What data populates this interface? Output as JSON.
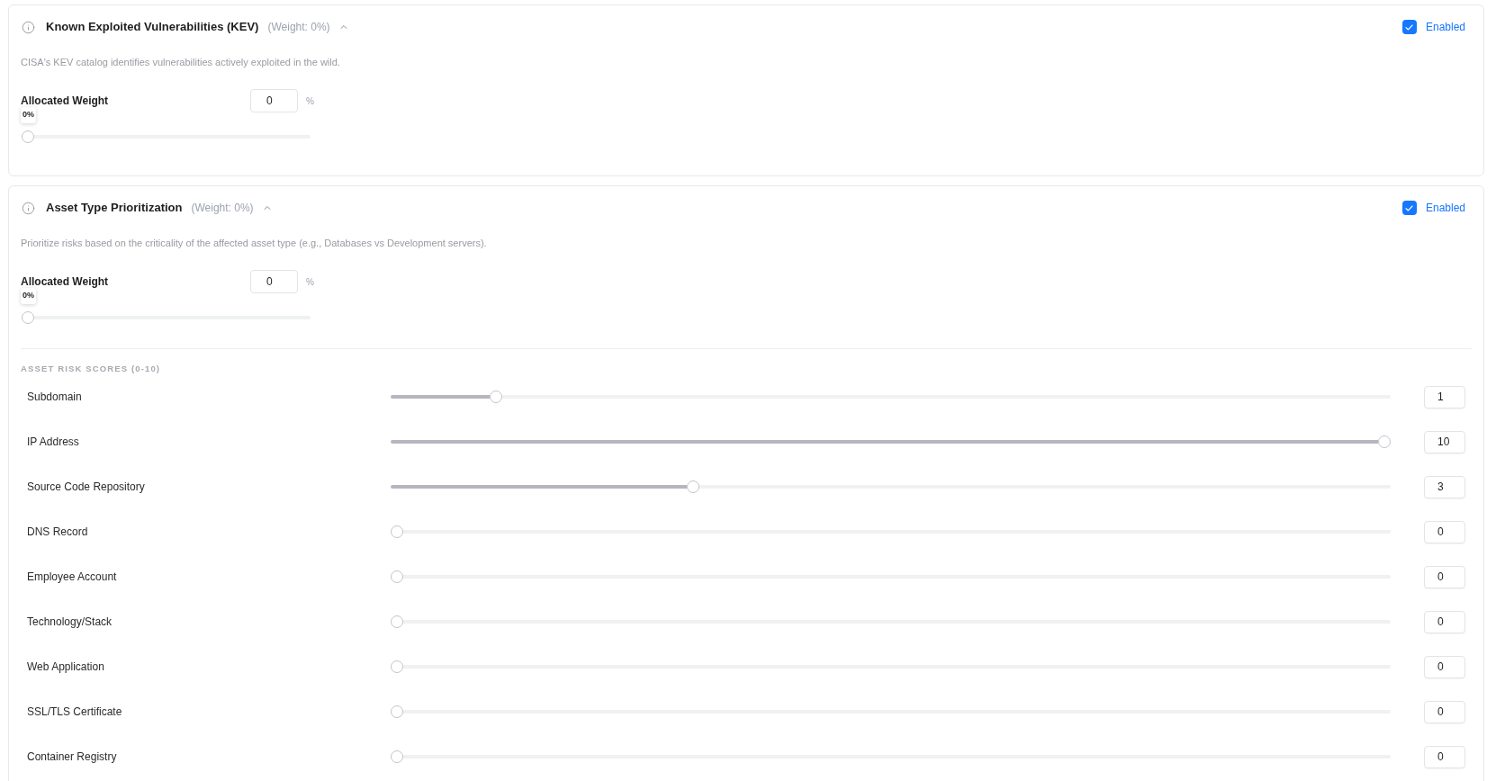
{
  "sections": [
    {
      "title": "Known Exploited Vulnerabilities (KEV)",
      "weight_label": "(Weight: 0%)",
      "expanded": true,
      "enabled": {
        "label": "Enabled",
        "checked": true
      },
      "description": "CISA's KEV catalog identifies vulnerabilities actively exploited in the wild.",
      "allocated_weight": {
        "label": "Allocated Weight",
        "value": "0",
        "unit": "%",
        "tooltip": "0%",
        "level": 0
      }
    },
    {
      "title": "Asset Type Prioritization",
      "weight_label": "(Weight: 0%)",
      "expanded": true,
      "enabled": {
        "label": "Enabled",
        "checked": true
      },
      "description": "Prioritize risks based on the criticality of the affected asset type (e.g., Databases vs Development servers).",
      "allocated_weight": {
        "label": "Allocated Weight",
        "value": "0",
        "unit": "%",
        "tooltip": "0%",
        "level": 0
      },
      "scores": {
        "heading": "ASSET RISK SCORES (0-10)",
        "rows": [
          {
            "label": "Subdomain",
            "level": 0.1,
            "value": "1"
          },
          {
            "label": "IP Address",
            "level": 1,
            "value": "10"
          },
          {
            "label": "Source Code Repository",
            "level": 0.3,
            "value": "3"
          },
          {
            "label": "DNS Record",
            "level": 0,
            "value": "0"
          },
          {
            "label": "Employee Account",
            "level": 0,
            "value": "0"
          },
          {
            "label": "Technology/Stack",
            "level": 0,
            "value": "0"
          },
          {
            "label": "Web Application",
            "level": 0,
            "value": "0"
          },
          {
            "label": "SSL/TLS Certificate",
            "level": 0,
            "value": "0"
          },
          {
            "label": "Container Registry",
            "level": 0,
            "value": "0"
          }
        ]
      }
    }
  ]
}
